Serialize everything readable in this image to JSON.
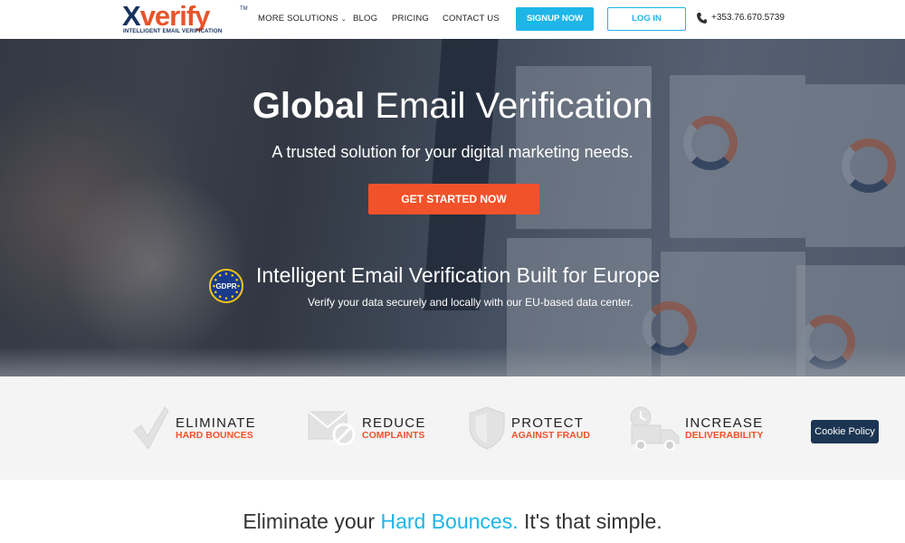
{
  "brand": {
    "name_x": "X",
    "name_rest": "verify",
    "tm": "TM",
    "tagline": "INTELLIGENT EMAIL VERIFICATION"
  },
  "nav": {
    "more_solutions": "MORE SOLUTIONS",
    "blog": "BLOG",
    "pricing": "PRICING",
    "contact": "CONTACT US",
    "signup": "SIGNUP NOW",
    "login": "LOG IN",
    "phone": "+353.76.670.5739"
  },
  "hero": {
    "title_bold": "Global",
    "title_rest": " Email Verification",
    "subtitle": "A trusted solution for your digital marketing needs.",
    "cta": "GET STARTED NOW",
    "gdpr_label": "GDPR",
    "eu_title": "Intelligent Email Verification Built for Europe",
    "eu_subtitle": "Verify your data securely and locally with our EU-based data center."
  },
  "features": [
    {
      "title": "ELIMINATE",
      "sub": "HARD BOUNCES"
    },
    {
      "title": "REDUCE",
      "sub": "COMPLAINTS"
    },
    {
      "title": "PROTECT",
      "sub": "AGAINST FRAUD"
    },
    {
      "title": "INCREASE",
      "sub": "DELIVERABILITY"
    }
  ],
  "cookie": "Cookie Policy",
  "bottom": {
    "pre": "Eliminate your ",
    "highlight": "Hard Bounces.",
    "post": " It's that simple."
  },
  "colors": {
    "accent_blue": "#1fb5e8",
    "accent_orange": "#f2522a",
    "navy": "#17325f"
  }
}
